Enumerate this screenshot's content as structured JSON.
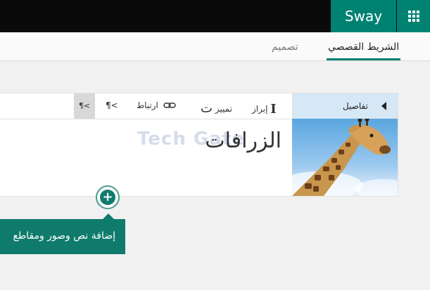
{
  "header": {
    "app_title": "Sway"
  },
  "tabs": [
    {
      "label": "الشريط القصصي",
      "active": true
    },
    {
      "label": "تصميم",
      "active": false
    }
  ],
  "toolbar": {
    "bold_label": "إبراز",
    "bold_icon_glyph": "I",
    "emphasis_label": "تمييز",
    "emphasis_icon_glyph": "ت",
    "link_label": "ارتباط",
    "rtl_label": "¶<",
    "more_label": "¶<",
    "details_label": "تفاصيل"
  },
  "card": {
    "title": "الزرافات",
    "watermark": "Tech Gate"
  },
  "add_tooltip": {
    "plus_glyph": "+",
    "text": "إضافة نص وصور ومقاطع"
  },
  "colors": {
    "accent": "#008272",
    "tooltip": "#0f7b6c",
    "details_bg": "#d6e7f6"
  }
}
